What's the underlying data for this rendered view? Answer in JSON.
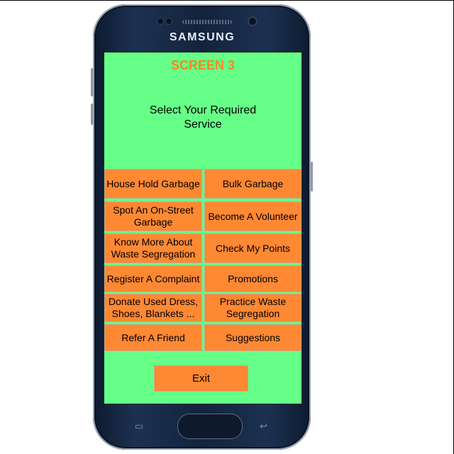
{
  "device": {
    "brand": "SAMSUNG"
  },
  "screen": {
    "title": "SCREEN 3",
    "prompt_line1": "Select Your Required",
    "prompt_line2": "Service"
  },
  "services": {
    "household_garbage": "House Hold Garbage",
    "bulk_garbage": "Bulk Garbage",
    "spot_garbage_l1": "Spot An On-Street",
    "spot_garbage_l2": "Garbage",
    "volunteer": "Become A Volunteer",
    "know_more_l1": "Know More About",
    "know_more_l2": "Waste Segregation",
    "check_points": "Check My Points",
    "complaint": "Register A Complaint",
    "promotions": "Promotions",
    "donate_l1": "Donate Used Dress,",
    "donate_l2": "Shoes, Blankets ...",
    "practice_l1": "Practice Waste",
    "practice_l2": "Segregation",
    "refer": "Refer A Friend",
    "suggestions": "Suggestions"
  },
  "exit_label": "Exit",
  "nav": {
    "recent_glyph": "▭",
    "back_glyph": "↩"
  },
  "colors": {
    "screen_bg": "#66ff88",
    "button_bg": "#ff8833",
    "title": "#f08a20"
  }
}
